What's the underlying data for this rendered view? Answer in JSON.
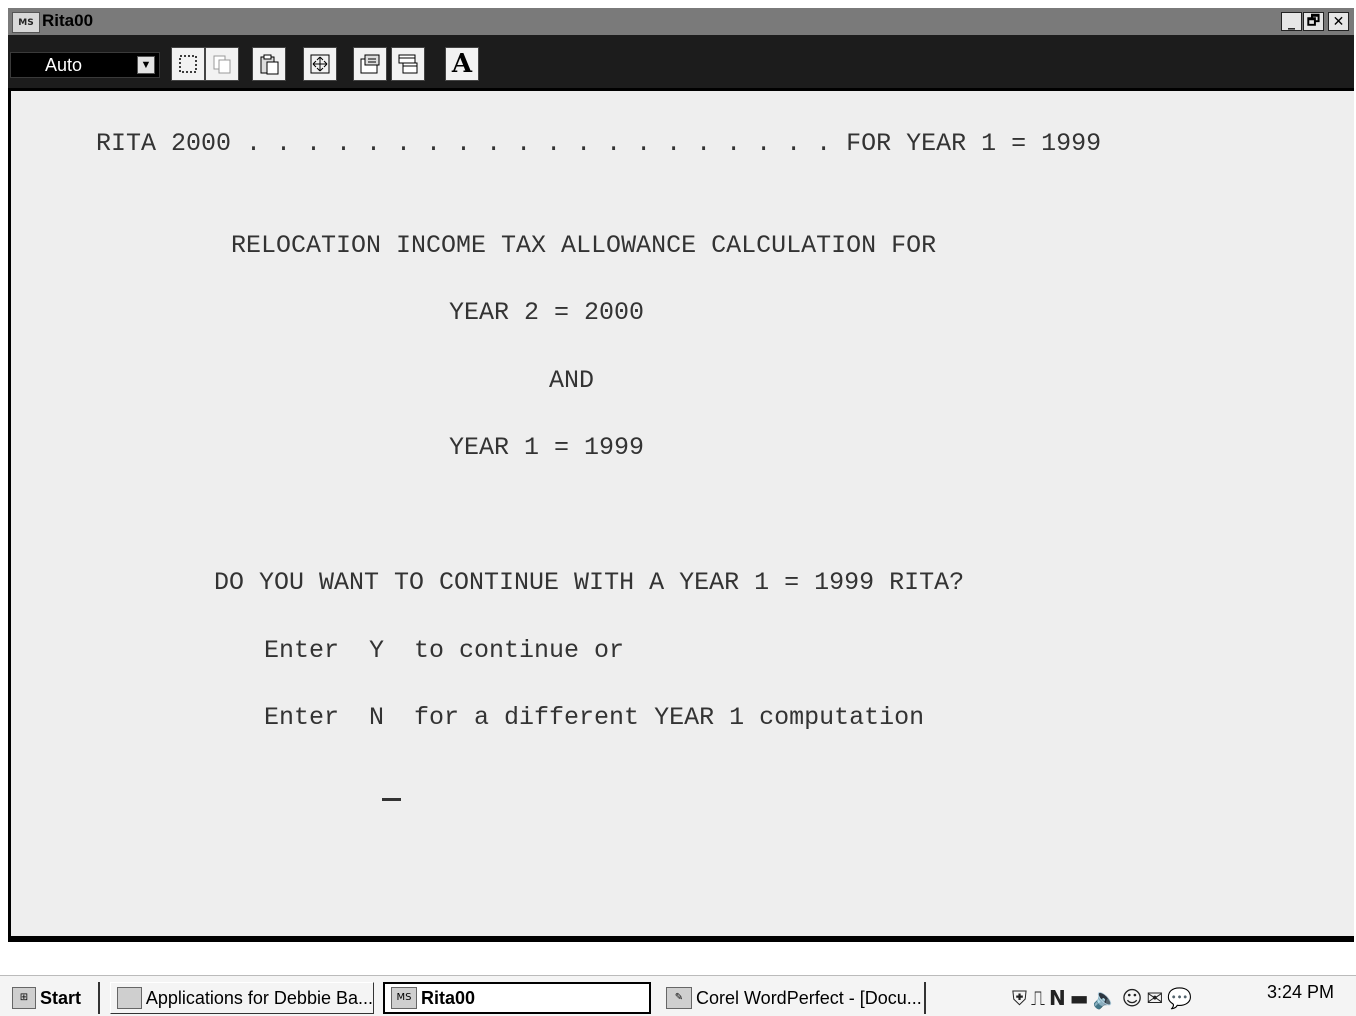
{
  "window": {
    "title": "Rita00",
    "icon": "ms-dos-icon",
    "controls": {
      "minimize": "_",
      "maximize": "🗗",
      "close": "✕"
    }
  },
  "toolbar": {
    "font_size_value": "Auto",
    "buttons": [
      "mark-icon",
      "copy-icon",
      "paste-icon",
      "fullscreen-icon",
      "properties-icon",
      "background-icon",
      "font-icon"
    ],
    "font_button_label": "A"
  },
  "console": {
    "lines": [
      "RITA 2000 . . . . . . . . . . . . . . . . . . . . FOR YEAR 1 = 1999",
      "RELOCATION INCOME TAX ALLOWANCE CALCULATION FOR",
      "YEAR 2 = 2000",
      "AND",
      "YEAR 1 = 1999",
      "DO YOU WANT TO CONTINUE WITH A YEAR 1 = 1999 RITA?",
      "Enter  Y  to continue or",
      "Enter  N  for a different YEAR 1 computation"
    ]
  },
  "taskbar": {
    "start_label": "Start",
    "tasks": [
      {
        "label": "Applications for Debbie Ba...",
        "icon": "folder-icon"
      },
      {
        "label": "Rita00",
        "icon": "ms-dos-icon"
      },
      {
        "label": "Corel WordPerfect - [Docu...",
        "icon": "wordperfect-icon"
      }
    ],
    "tray_icons": [
      "shield-icon",
      "network-icon",
      "n-icon",
      "3com-icon",
      "speaker-icon",
      "user-icon",
      "mail-icon",
      "chat-icon"
    ],
    "clock": "3:24 PM"
  }
}
